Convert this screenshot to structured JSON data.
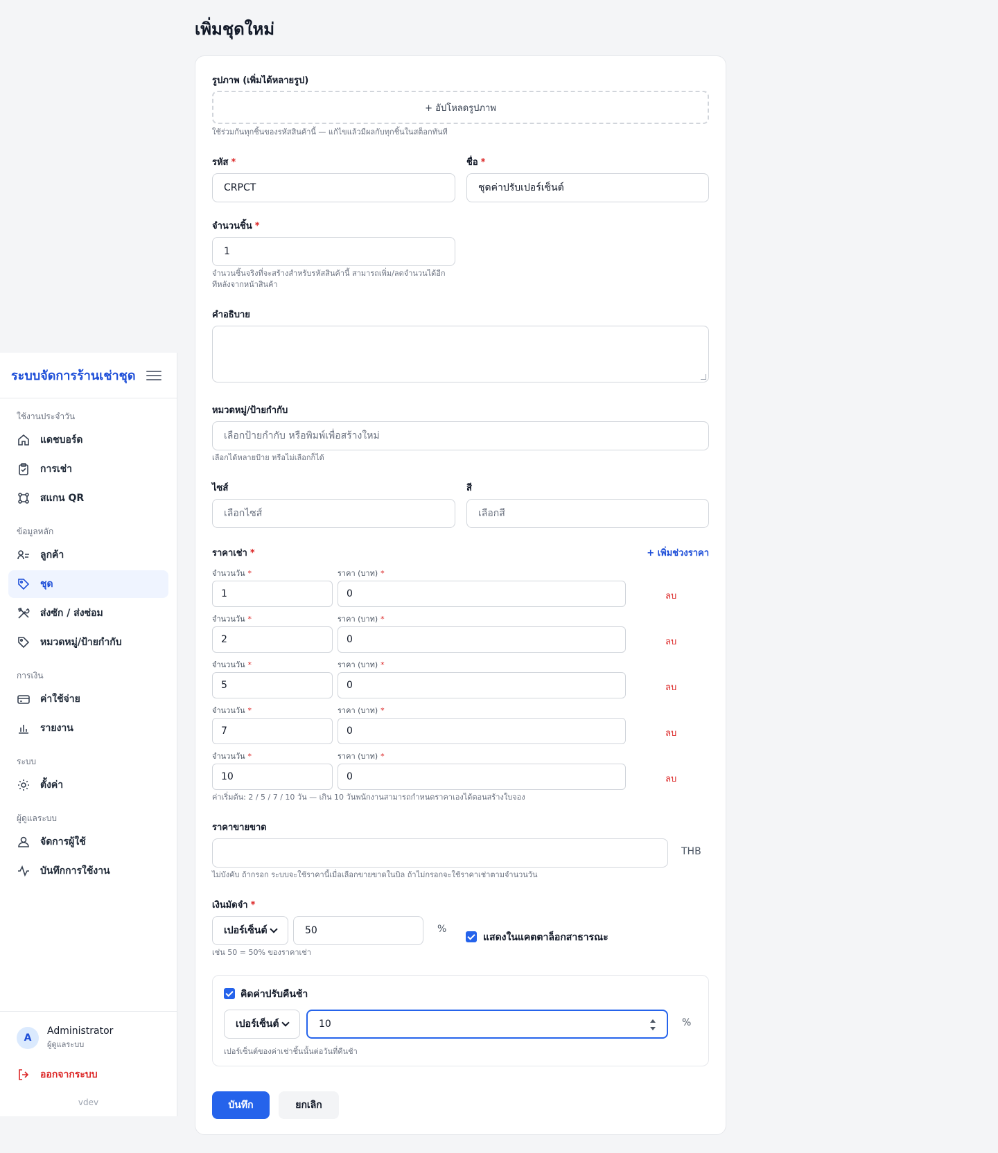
{
  "page": {
    "title": "เพิ่มชุดใหม่"
  },
  "sidebar": {
    "brand": "ระบบจัดการร้านเช่าชุด",
    "sections": [
      {
        "title": "ใช้งานประจำวัน",
        "items": [
          {
            "label": "แดชบอร์ด",
            "icon": "home-icon"
          },
          {
            "label": "การเช่า",
            "icon": "clipboard-icon"
          },
          {
            "label": "สแกน QR",
            "icon": "qr-scan-icon"
          }
        ]
      },
      {
        "title": "ข้อมูลหลัก",
        "items": [
          {
            "label": "ลูกค้า",
            "icon": "users-icon"
          },
          {
            "label": "ชุด",
            "icon": "tag-icon",
            "active": true
          },
          {
            "label": "ส่งซัก / ส่งซ่อม",
            "icon": "tools-icon"
          },
          {
            "label": "หมวดหมู่/ป้ายกำกับ",
            "icon": "label-icon"
          }
        ]
      },
      {
        "title": "การเงิน",
        "items": [
          {
            "label": "ค่าใช้จ่าย",
            "icon": "credit-card-icon"
          },
          {
            "label": "รายงาน",
            "icon": "bar-chart-icon"
          }
        ]
      },
      {
        "title": "ระบบ",
        "items": [
          {
            "label": "ตั้งค่า",
            "icon": "gear-icon"
          }
        ]
      },
      {
        "title": "ผู้ดูแลระบบ",
        "items": [
          {
            "label": "จัดการผู้ใช้",
            "icon": "user-icon"
          },
          {
            "label": "บันทึกการใช้งาน",
            "icon": "activity-icon"
          }
        ]
      }
    ],
    "user": {
      "initial": "A",
      "name": "Administrator",
      "role": "ผู้ดูแลระบบ"
    },
    "logout_label": "ออกจากระบบ",
    "version": "vdev"
  },
  "form": {
    "images": {
      "label": "รูปภาพ (เพิ่มได้หลายรูป)",
      "upload_label": "+ อัปโหลดรูปภาพ",
      "hint": "ใช้ร่วมกันทุกชิ้นของรหัสสินค้านี้ — แก้ไขแล้วมีผลกับทุกชิ้นในสต็อกทันที"
    },
    "code": {
      "label": "รหัส",
      "required_mark": "*",
      "value": "CRPCT"
    },
    "name": {
      "label": "ชื่อ",
      "required_mark": "*",
      "value": "ชุดค่าปรับเปอร์เซ็นต์"
    },
    "quantity": {
      "label": "จำนวนชิ้น",
      "required_mark": "*",
      "value": "1",
      "hint_line1": "จำนวนชิ้นจริงที่จะสร้างสำหรับรหัสสินค้านี้ สามารถเพิ่ม/ลดจำนวนได้อีก",
      "hint_line2": "ทีหลังจากหน้าสินค้า"
    },
    "description": {
      "label": "คำอธิบาย",
      "value": ""
    },
    "tags": {
      "label": "หมวดหมู่/ป้ายกำกับ",
      "placeholder": "เลือกป้ายกำกับ หรือพิมพ์เพื่อสร้างใหม่",
      "hint": "เลือกได้หลายป้าย หรือไม่เลือกก็ได้"
    },
    "size": {
      "label": "ไซส์",
      "placeholder": "เลือกไซส์"
    },
    "color": {
      "label": "สี",
      "placeholder": "เลือกสี"
    },
    "rental_price": {
      "label": "ราคาเช่า",
      "required_mark": "*",
      "add_range_label": "+ เพิ่มช่วงราคา",
      "days_label": "จำนวนวัน",
      "price_label": "ราคา (บาท)",
      "delete_label": "ลบ",
      "rows": [
        {
          "days": "1",
          "price": "0"
        },
        {
          "days": "2",
          "price": "0"
        },
        {
          "days": "5",
          "price": "0"
        },
        {
          "days": "7",
          "price": "0"
        },
        {
          "days": "10",
          "price": "0"
        }
      ],
      "hint": "ค่าเริ่มต้น: 2 / 5 / 7 / 10 วัน — เกิน 10 วันพนักงานสามารถกำหนดราคาเองได้ตอนสร้างใบจอง"
    },
    "sale_price": {
      "label": "ราคาขายขาด",
      "value": "",
      "unit": "THB",
      "hint": "ไม่บังคับ ถ้ากรอก ระบบจะใช้ราคานี้เมื่อเลือกขายขาดในบิล ถ้าไม่กรอกจะใช้ราคาเช่าตามจำนวนวัน"
    },
    "deposit": {
      "label": "เงินมัดจำ",
      "required_mark": "*",
      "type": "เปอร์เซ็นต์",
      "value": "50",
      "unit": "%",
      "hint": "เช่น 50 = 50% ของราคาเช่า",
      "public_catalog_label": "แสดงในแคตตาล็อกสาธารณะ",
      "public_catalog_checked": true
    },
    "late_fee": {
      "label": "คิดค่าปรับคืนช้า",
      "checked": true,
      "type": "เปอร์เซ็นต์",
      "value": "10",
      "unit": "%",
      "hint": "เปอร์เซ็นต์ของค่าเช่าชิ้นนั้นต่อวันที่คืนช้า"
    },
    "save_label": "บันทึก",
    "cancel_label": "ยกเลิก"
  },
  "colors": {
    "accent": "#2563eb",
    "brand": "#1d4ed8",
    "danger": "#dc2626",
    "active_bg": "#eff4ff"
  }
}
